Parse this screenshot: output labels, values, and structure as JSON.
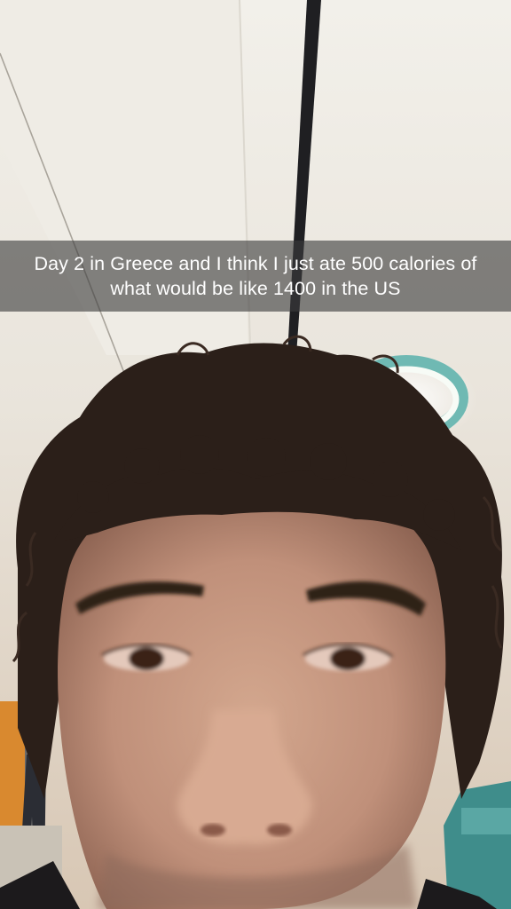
{
  "caption": {
    "text": "Day 2 in Greece and I think I just ate 500 calories of what would be like 1400 in the US"
  },
  "photo": {
    "ceiling_color": "#ece9e1",
    "wall_color": "#e6ddd0",
    "hair_color": "#2b1f19",
    "skin_color": "#c79a82",
    "lamp_color": "#6fb9b3",
    "door_color": "#d9892f",
    "chair_color": "#3f8d8b"
  }
}
